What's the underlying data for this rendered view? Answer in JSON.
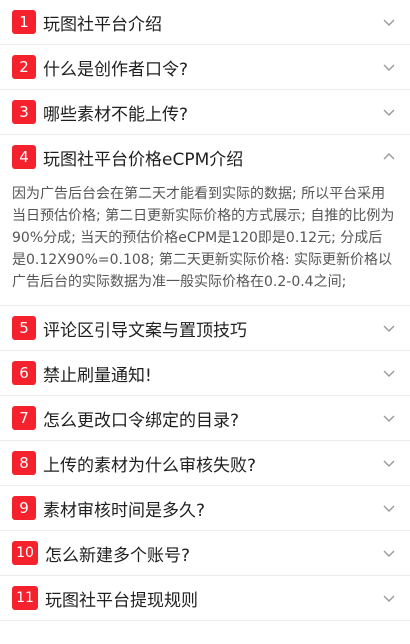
{
  "faq": {
    "items": [
      {
        "num": "1",
        "question": "玩图社平台介绍",
        "expanded": false
      },
      {
        "num": "2",
        "question": "什么是创作者口令?",
        "expanded": false
      },
      {
        "num": "3",
        "question": "哪些素材不能上传?",
        "expanded": false
      },
      {
        "num": "4",
        "question": "玩图社平台价格eCPM介绍",
        "expanded": true,
        "answer": "因为广告后台会在第二天才能看到实际的数据; 所以平台采用当日预估价格; 第二日更新实际价格的方式展示; 自推的比例为90%分成; 当天的预估价格eCPM是120即是0.12元; 分成后是0.12X90%=0.108; 第二天更新实际价格: 实际更新价格以广告后台的实际数据为准一般实际价格在0.2-0.4之间;"
      },
      {
        "num": "5",
        "question": "评论区引导文案与置顶技巧",
        "expanded": false
      },
      {
        "num": "6",
        "question": "禁止刷量通知!",
        "expanded": false
      },
      {
        "num": "7",
        "question": "怎么更改口令绑定的目录?",
        "expanded": false
      },
      {
        "num": "8",
        "question": "上传的素材为什么审核失败?",
        "expanded": false
      },
      {
        "num": "9",
        "question": "素材审核时间是多久?",
        "expanded": false
      },
      {
        "num": "10",
        "question": "怎么新建多个账号?",
        "expanded": false
      },
      {
        "num": "11",
        "question": "玩图社平台提现规则",
        "expanded": false
      }
    ]
  },
  "colors": {
    "badge": "#f5222d",
    "chevron": "#999999"
  },
  "icons": {
    "collapsed": "chevron-down-icon",
    "expanded": "chevron-up-icon"
  }
}
